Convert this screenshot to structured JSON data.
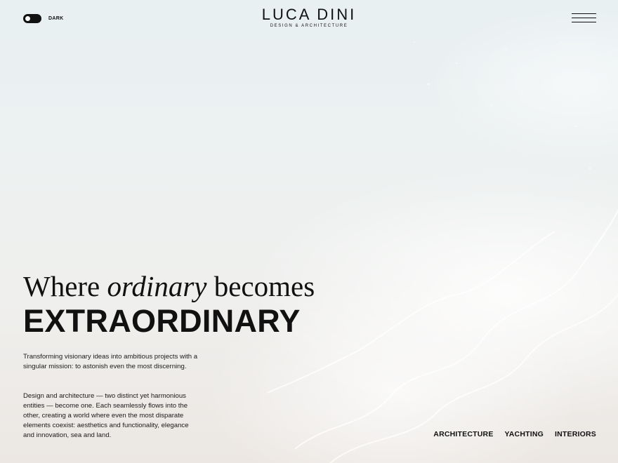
{
  "header": {
    "toggle_label": "DARK",
    "logo_name": "LUCA DINI",
    "logo_tagline": "DESIGN & ARCHITECTURE",
    "menu_icon": "hamburger-menu-icon",
    "toggle_icon": "toggle-switch-icon"
  },
  "hero": {
    "line1_before": "Where ",
    "line1_italic": "ordinary",
    "line1_after": " becomes",
    "line2": "EXTRAORDINARY",
    "paragraph1": "Transforming visionary ideas into ambitious projects with a singular mission: to astonish even the most discerning.",
    "paragraph2": "Design and architecture — two distinct yet harmonious entities — become one. Each seamlessly flows into the other, creating a world where even the most disparate elements coexist: aesthetics and functionality, elegance and innovation, sea and land."
  },
  "categories": [
    "ARCHITECTURE",
    "YACHTING",
    "INTERIORS"
  ],
  "colors": {
    "text": "#111111",
    "background_top": "#e8f0f2",
    "background_bottom": "#ece7e3"
  }
}
